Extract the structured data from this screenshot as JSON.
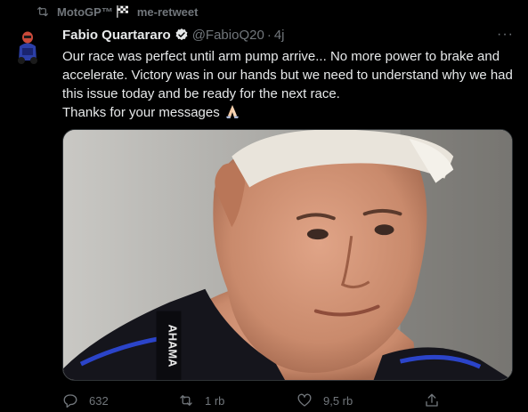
{
  "retweet": {
    "user": "MotoGP™",
    "action": "me-retweet"
  },
  "tweet": {
    "author_name": "Fabio Quartararo",
    "handle": "@FabioQ20",
    "separator": "·",
    "time": "4j",
    "more": "···",
    "text": "Our race was perfect until arm pump arrive... No more power to brake and accelerate. Victory was in our hands but we need to understand why we had this issue today and be ready for the next race.\nThanks for your messages",
    "photo_print": "AHAMA"
  },
  "actions": {
    "replies": "632",
    "retweets": "1 rb",
    "likes": "9,5 rb"
  },
  "icons": {
    "retweet": "retweet-icon",
    "flag": "checkered-flag-icon",
    "verified": "verified-badge-icon",
    "emoji": "folded-hands-emoji",
    "reply": "reply-icon",
    "like": "heart-icon",
    "share": "share-icon"
  },
  "colors": {
    "background": "#000000",
    "text": "#e7e9ea",
    "muted": "#71767b"
  }
}
